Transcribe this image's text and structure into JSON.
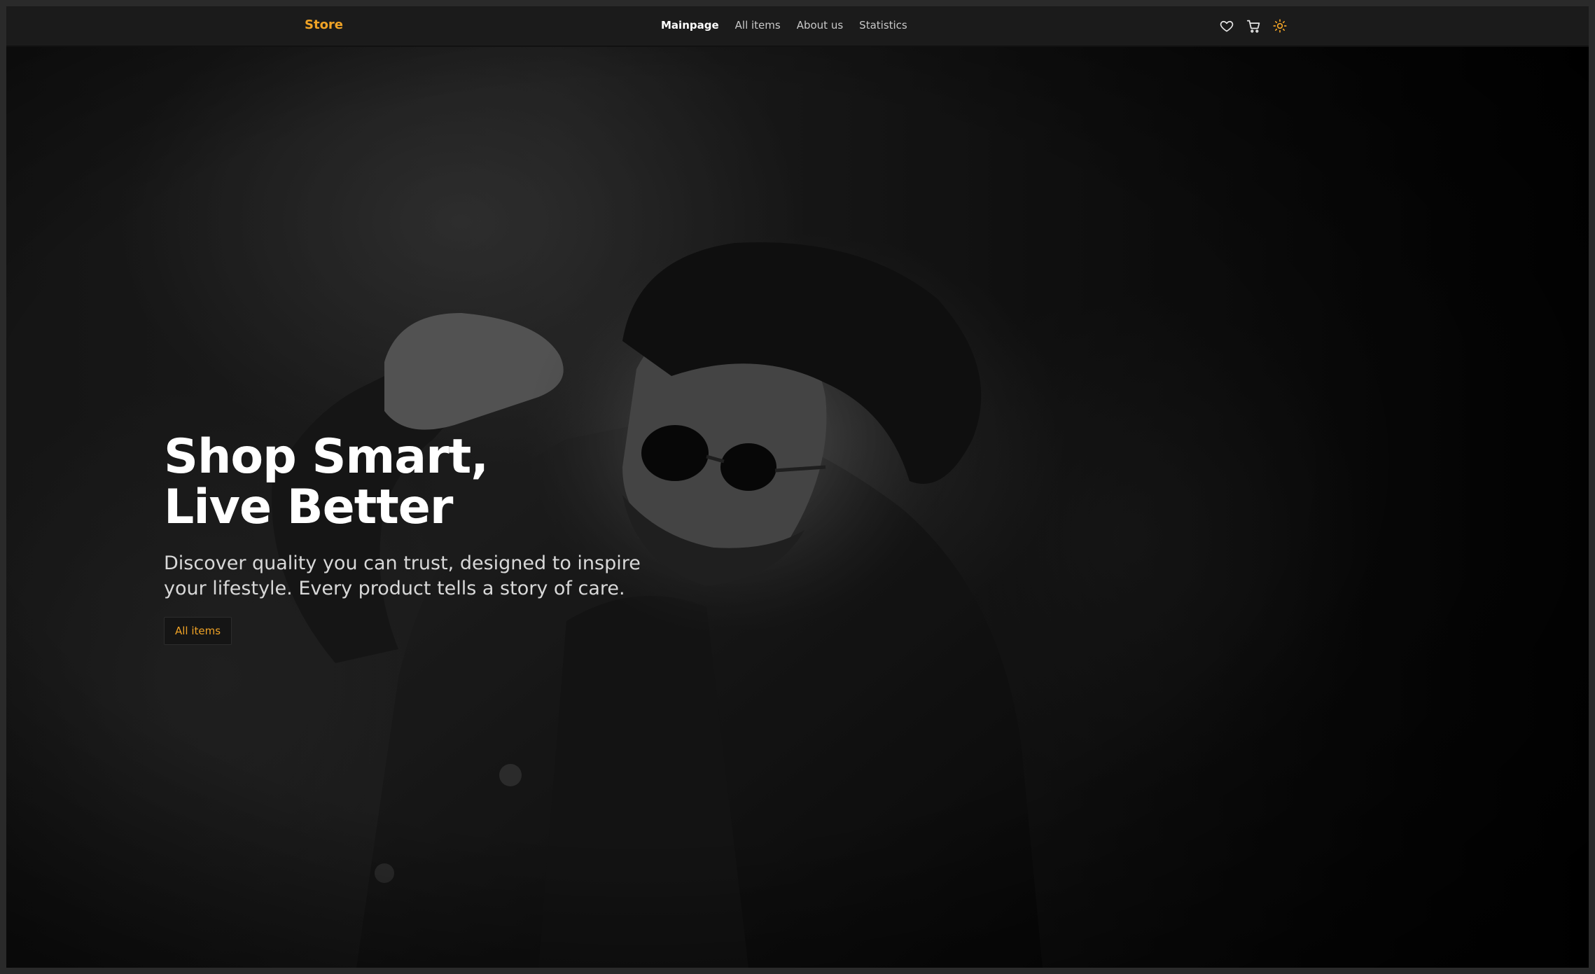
{
  "header": {
    "brand": "Store",
    "nav": [
      {
        "label": "Mainpage",
        "active": true
      },
      {
        "label": "All items",
        "active": false
      },
      {
        "label": "About us",
        "active": false
      },
      {
        "label": "Statistics",
        "active": false
      }
    ],
    "icons": [
      "heart-icon",
      "cart-icon",
      "sun-icon"
    ]
  },
  "hero": {
    "title_line1": "Shop Smart,",
    "title_line2": "Live Better",
    "subtitle": "Discover quality you can trust, designed to inspire your lifestyle. Every product tells a story of care.",
    "cta_label": "All items"
  },
  "colors": {
    "accent": "#f0a326",
    "header_bg": "#1b1b1b",
    "text": "#ffffff"
  }
}
